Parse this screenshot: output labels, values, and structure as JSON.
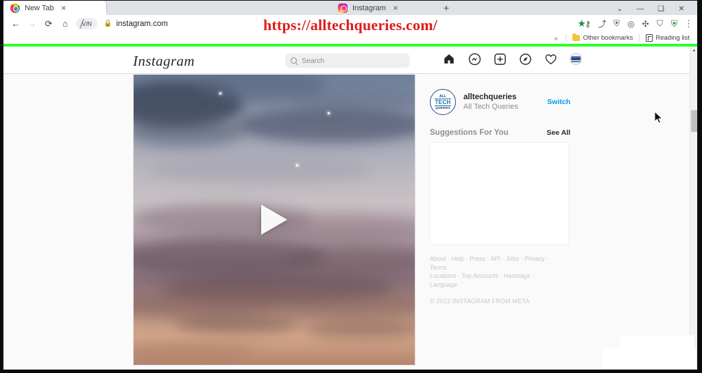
{
  "browser": {
    "tabs": [
      {
        "title": "New Tab",
        "favicon": "chrome-icon",
        "active": true
      },
      {
        "title": "Instagram",
        "favicon": "instagram-icon",
        "active": false
      }
    ],
    "new_tab_label": "+",
    "close_label": "×",
    "window_controls": [
      {
        "name": "tab-search-chevron",
        "glyph": "⌄"
      },
      {
        "name": "minimize",
        "glyph": "—"
      },
      {
        "name": "maximize",
        "glyph": "❑"
      },
      {
        "name": "close",
        "glyph": "✕"
      }
    ],
    "nav": {
      "back": "←",
      "forward": "→",
      "reload": "⟳",
      "home": "⌂",
      "vpn_chip": "V/N",
      "lock": "🔒",
      "url": "instagram.com"
    },
    "extensions": [
      {
        "name": "key-icon",
        "glyph": "⚷"
      },
      {
        "name": "share-icon",
        "glyph": "⤴"
      },
      {
        "name": "bookmark-star-icon",
        "glyph": "★",
        "color": "#1e8e3e"
      },
      {
        "name": "shield-icon",
        "glyph": "⛨"
      },
      {
        "name": "adblock-icon",
        "glyph": "◎"
      },
      {
        "name": "puzzle-extension-icon",
        "glyph": "✣"
      },
      {
        "name": "profile-icon",
        "glyph": "⛉"
      },
      {
        "name": "security-shield-icon",
        "glyph": "⛨",
        "color": "#1e8e3e"
      },
      {
        "name": "chrome-menu-icon",
        "glyph": "⋮"
      }
    ],
    "bookmarks": {
      "overflow_chevron": "»",
      "other_bookmarks": "Other bookmarks",
      "reading_list": "Reading list"
    }
  },
  "overlay": {
    "watermark_url": "https://alltechqueries.com/",
    "watermark_color": "#e01b1b"
  },
  "instagram": {
    "logo": "Instagram",
    "search": {
      "placeholder": "Search",
      "value": ""
    },
    "nav_icons": [
      {
        "name": "home-icon",
        "label": "Home"
      },
      {
        "name": "messenger-icon",
        "label": "Messages"
      },
      {
        "name": "new-post-icon",
        "label": "New post"
      },
      {
        "name": "explore-compass-icon",
        "label": "Explore"
      },
      {
        "name": "activity-heart-icon",
        "label": "Activity"
      },
      {
        "name": "profile-avatar",
        "label": "Profile"
      }
    ],
    "post": {
      "media_type": "video",
      "play_button_label": "Play",
      "alt": "Twilight sky with clouds and stars at sunset"
    },
    "sidebar": {
      "username": "alltechqueries",
      "fullname": "All Tech Queries",
      "switch_label": "Switch",
      "avatar_text": {
        "top": "ALL",
        "middle": "TECH",
        "bottom": "QUERIES"
      },
      "suggestions_title": "Suggestions For You",
      "see_all_label": "See All",
      "footer_links_line1": "About · Help · Press · API · Jobs · Privacy · Terms ·",
      "footer_links_line2": "Locations · Top Accounts · Hashtags · Language",
      "copyright": "© 2022 INSTAGRAM FROM META"
    }
  },
  "accent_colors": {
    "instagram_blue": "#0095f6",
    "green_divider": "#2dff2d",
    "chrome_tabstrip": "#dee1e6"
  }
}
